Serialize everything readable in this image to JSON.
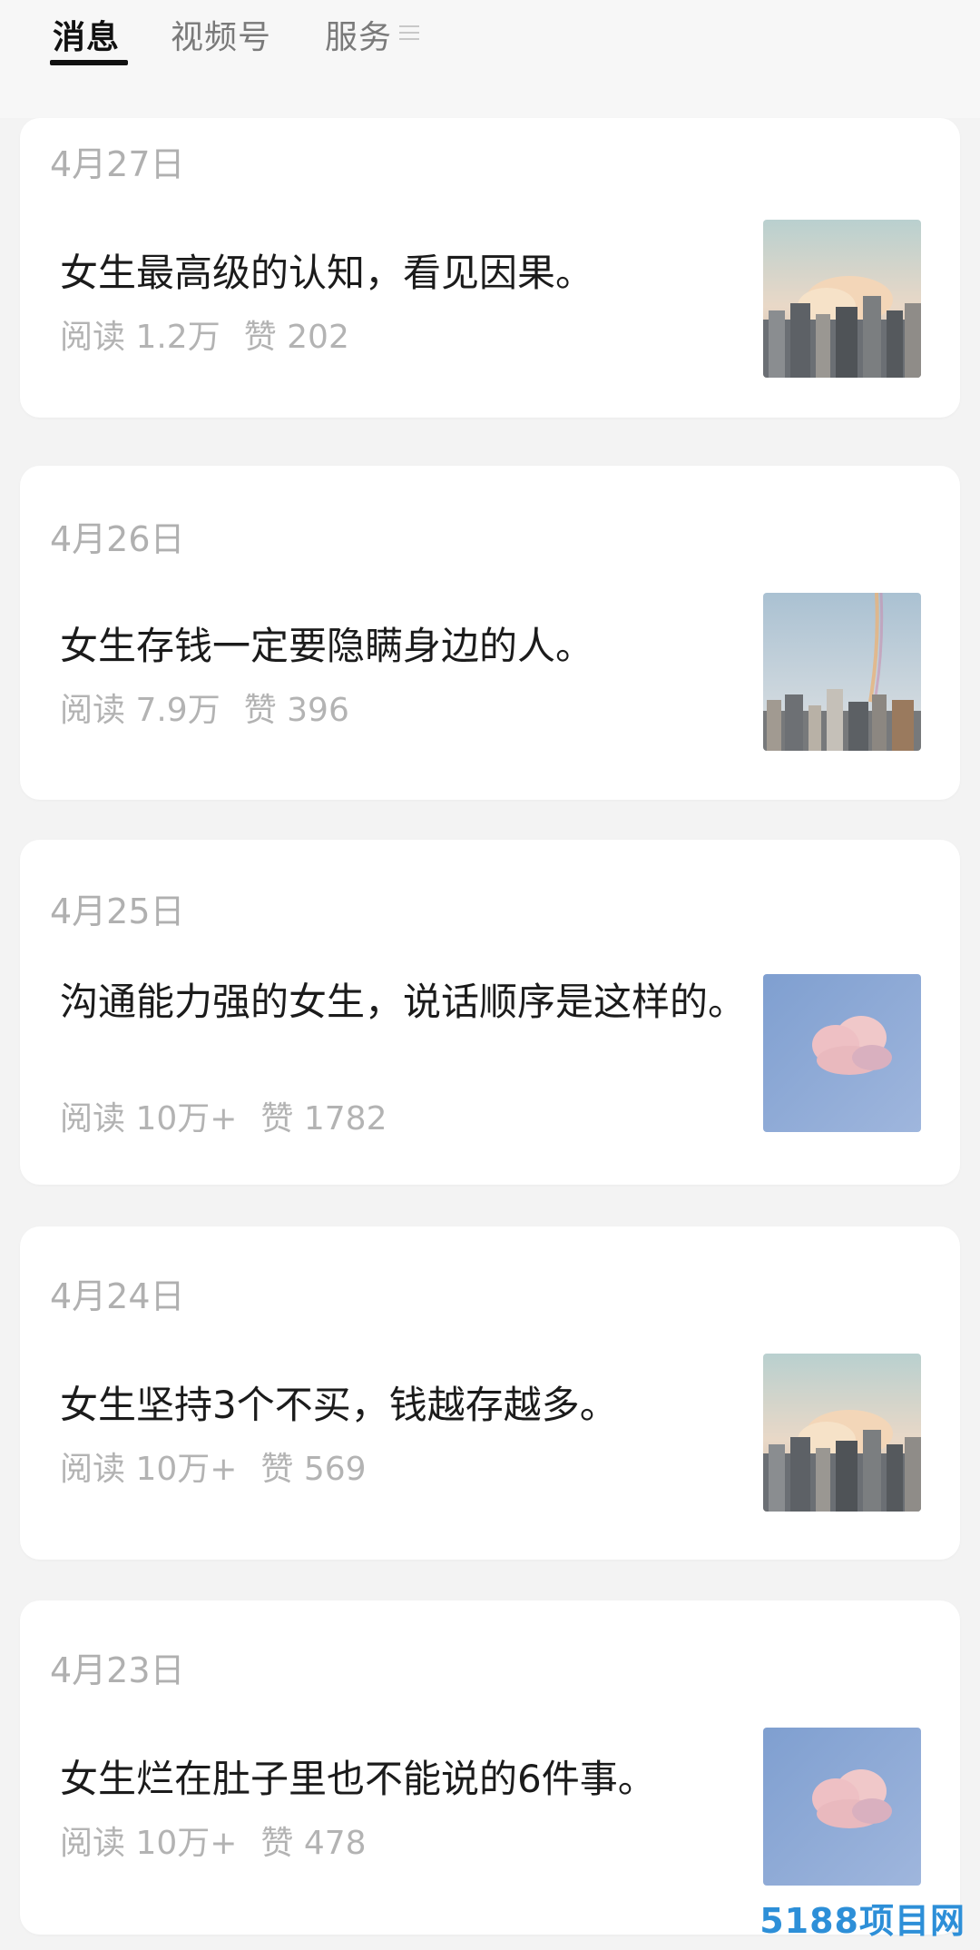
{
  "tabs": [
    {
      "label": "消息"
    },
    {
      "label": "视频号"
    },
    {
      "label": "服务"
    }
  ],
  "icons": {
    "menu": "menu-icon"
  },
  "articles": [
    {
      "date": "4月27日",
      "title": "女生最高级的认知，看见因果。",
      "reads": "阅读 1.2万",
      "likes": "赞 202",
      "thumbnail": "city-cloud-sunset"
    },
    {
      "date": "4月26日",
      "title": "女生存钱一定要隐瞒身边的人。",
      "reads": "阅读 7.9万",
      "likes": "赞 396",
      "thumbnail": "city-rainbow"
    },
    {
      "date": "4月25日",
      "title": "沟通能力强的女生，说话顺序是这样的。",
      "reads": "阅读 10万+",
      "likes": "赞 1782",
      "thumbnail": "pink-cloud-blue-sky"
    },
    {
      "date": "4月24日",
      "title": "女生坚持3个不买，钱越存越多。",
      "reads": "阅读 10万+",
      "likes": "赞 569",
      "thumbnail": "city-cloud-sunset"
    },
    {
      "date": "4月23日",
      "title": "女生烂在肚子里也不能说的6件事。",
      "reads": "阅读 10万+",
      "likes": "赞 478",
      "thumbnail": "pink-cloud-blue-sky"
    }
  ],
  "watermark": "5188项目网",
  "colors": {
    "background": "#f3f3f3",
    "card": "#ffffff",
    "meta_text": "#b3b3b3",
    "title_text": "#1b1b1b",
    "watermark": "#2d8fd8"
  }
}
